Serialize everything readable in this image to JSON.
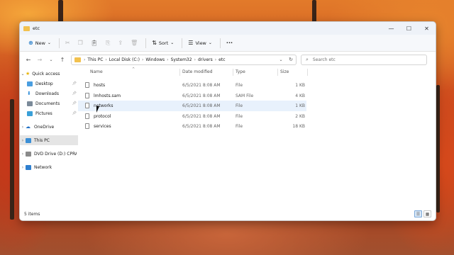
{
  "window": {
    "title": "etc",
    "controls": {
      "minimize": "—",
      "maximize": "☐",
      "close": "✕"
    }
  },
  "toolbar": {
    "new_label": "New",
    "sort_label": "Sort",
    "view_label": "View",
    "more_label": "···"
  },
  "address": {
    "crumbs": [
      "This PC",
      "Local Disk (C:)",
      "Windows",
      "System32",
      "drivers",
      "etc"
    ],
    "search_placeholder": "Search etc"
  },
  "sidebar": {
    "items": [
      {
        "label": "Quick access",
        "icon": "star-icon"
      },
      {
        "label": "Desktop",
        "icon": "desktop-icon"
      },
      {
        "label": "Downloads",
        "icon": "download-icon"
      },
      {
        "label": "Documents",
        "icon": "documents-icon"
      },
      {
        "label": "Pictures",
        "icon": "pictures-icon"
      },
      {
        "label": "OneDrive",
        "icon": "cloud-icon"
      },
      {
        "label": "This PC",
        "icon": "computer-icon"
      },
      {
        "label": "DVD Drive (D:) CPRA",
        "icon": "dvd-icon"
      },
      {
        "label": "Network",
        "icon": "network-icon"
      }
    ]
  },
  "columns": {
    "name": "Name",
    "date": "Date modified",
    "type": "Type",
    "size": "Size"
  },
  "files": [
    {
      "name": "hosts",
      "date": "6/5/2021 8:08 AM",
      "type": "File",
      "size": "1 KB"
    },
    {
      "name": "lmhosts.sam",
      "date": "6/5/2021 8:08 AM",
      "type": "SAM File",
      "size": "4 KB"
    },
    {
      "name": "networks",
      "date": "6/5/2021 8:08 AM",
      "type": "File",
      "size": "1 KB"
    },
    {
      "name": "protocol",
      "date": "6/5/2021 8:08 AM",
      "type": "File",
      "size": "2 KB"
    },
    {
      "name": "services",
      "date": "6/5/2021 8:08 AM",
      "type": "File",
      "size": "18 KB"
    }
  ],
  "status": {
    "item_count": "5 items"
  },
  "colors": {
    "accent": "#0067c0",
    "hover_row": "#e8f1fc",
    "selected_nav": "#e5e5e5",
    "folder": "#f2c14e"
  }
}
